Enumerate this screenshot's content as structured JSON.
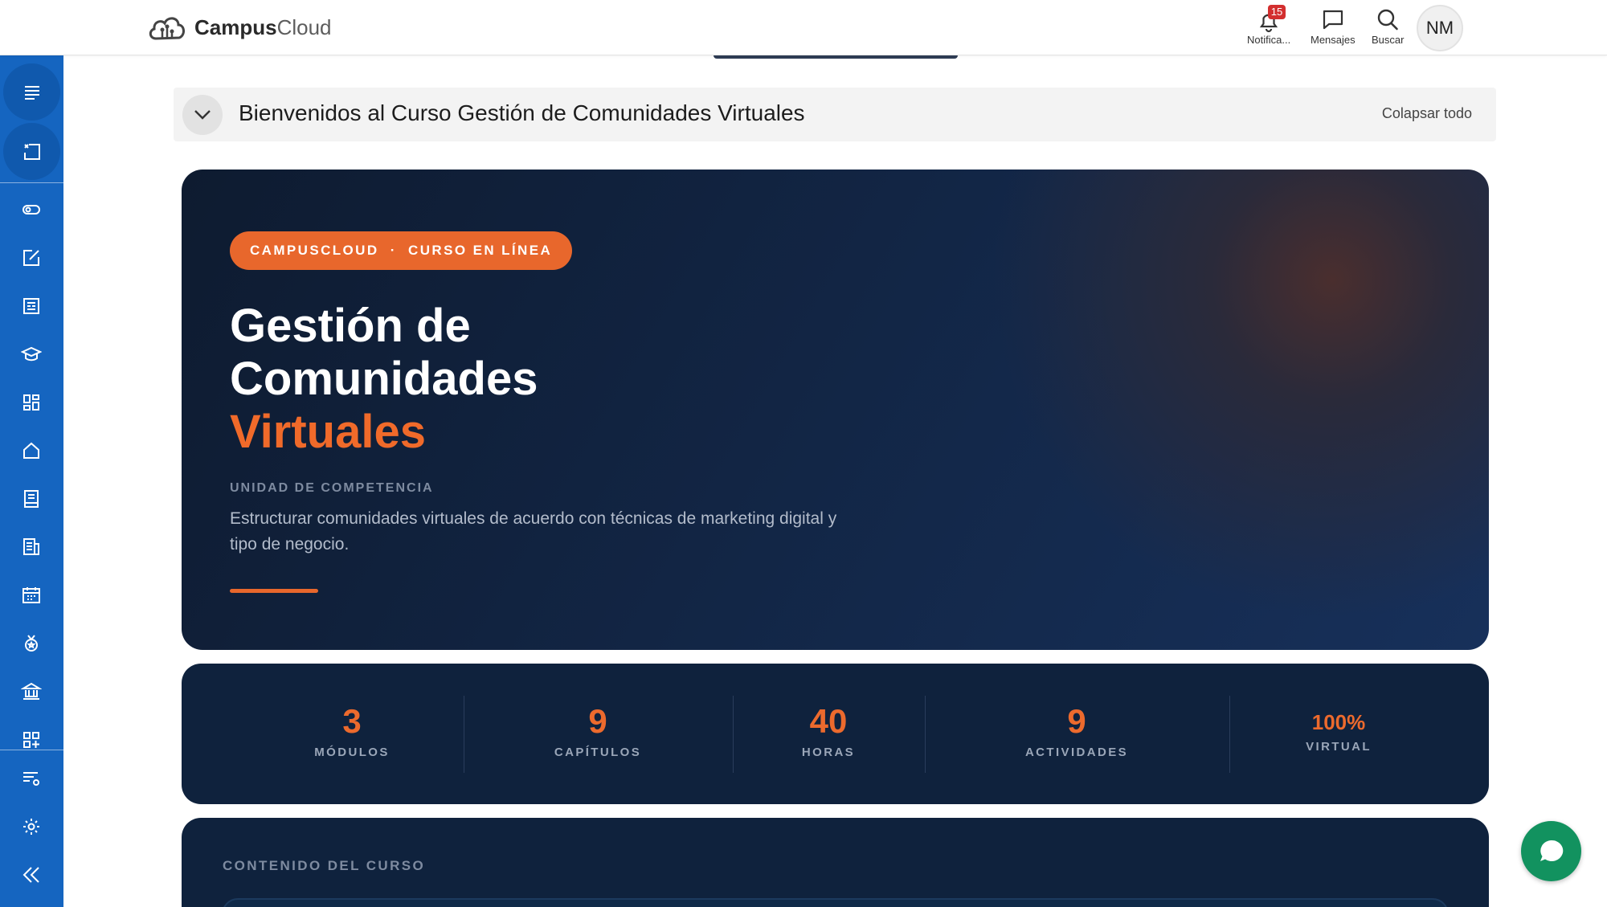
{
  "brand": {
    "name_bold": "Campus",
    "name_light": "Cloud"
  },
  "topbar": {
    "notifications": {
      "label": "Notifica...",
      "count": "15",
      "icon": "bell-icon"
    },
    "messages": {
      "label": "Mensajes",
      "icon": "chat-icon"
    },
    "search": {
      "label": "Buscar",
      "icon": "search-icon"
    },
    "user_initials": "NM"
  },
  "sidebar": {
    "items": [
      {
        "icon": "menu-icon"
      },
      {
        "icon": "course-index-icon"
      },
      {
        "icon": "toggle-icon"
      },
      {
        "icon": "edit-icon"
      },
      {
        "icon": "article-icon"
      },
      {
        "icon": "graduation-cap-icon"
      },
      {
        "icon": "dashboard-icon"
      },
      {
        "icon": "home-icon"
      },
      {
        "icon": "book-icon"
      },
      {
        "icon": "reports-icon"
      },
      {
        "icon": "calendar-icon"
      },
      {
        "icon": "badge-icon"
      },
      {
        "icon": "institution-icon"
      },
      {
        "icon": "add-block-icon"
      },
      {
        "icon": "filter-settings-icon"
      },
      {
        "icon": "settings-icon"
      },
      {
        "icon": "collapse-icon"
      }
    ]
  },
  "section": {
    "title": "Bienvenidos al Curso Gestión de Comunidades Virtuales",
    "collapse_label": "Colapsar todo"
  },
  "hero": {
    "pill": "CAMPUSCLOUD  ·  CURSO EN LÍNEA",
    "title_line1": "Gestión de",
    "title_line2": "Comunidades",
    "title_accent": "Virtuales",
    "unit_label": "UNIDAD DE COMPETENCIA",
    "unit_description": "Estructurar comunidades virtuales de acuerdo con técnicas de marketing digital y tipo de negocio."
  },
  "stats": [
    {
      "value": "3",
      "label": "MÓDULOS"
    },
    {
      "value": "9",
      "label": "CAPÍTULOS"
    },
    {
      "value": "40",
      "label": "HORAS"
    },
    {
      "value": "9",
      "label": "ACTIVIDADES"
    },
    {
      "value": "100%",
      "label": "VIRTUAL"
    }
  ],
  "content": {
    "label": "CONTENIDO DEL CURSO"
  },
  "colors": {
    "sidebar": "#1565c0",
    "accent": "#e8672c",
    "hero_bg": "#0e1b30",
    "chat": "#12925f"
  }
}
